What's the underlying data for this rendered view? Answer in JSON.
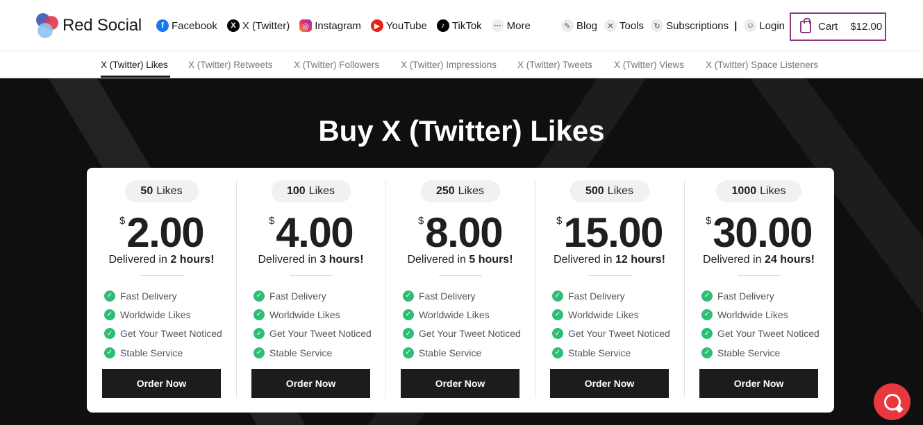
{
  "brand": {
    "name": "Red Social"
  },
  "nav": [
    {
      "label": "Facebook",
      "icon": "facebook-icon",
      "glyph": "f"
    },
    {
      "label": "X (Twitter)",
      "icon": "x-twitter-icon",
      "glyph": "X"
    },
    {
      "label": "Instagram",
      "icon": "instagram-icon",
      "glyph": "◎"
    },
    {
      "label": "YouTube",
      "icon": "youtube-icon",
      "glyph": "▶"
    },
    {
      "label": "TikTok",
      "icon": "tiktok-icon",
      "glyph": "♪"
    },
    {
      "label": "More",
      "icon": "more-icon",
      "glyph": "···"
    }
  ],
  "nav_right": {
    "blog": "Blog",
    "tools": "Tools",
    "subscriptions": "Subscriptions",
    "separator": "|",
    "login": "Login"
  },
  "cart": {
    "label": "Cart",
    "total": "$12.00"
  },
  "subnav": {
    "tabs": [
      {
        "label": "X (Twitter) Likes",
        "active": true
      },
      {
        "label": "X (Twitter) Retweets",
        "active": false
      },
      {
        "label": "X (Twitter) Followers",
        "active": false
      },
      {
        "label": "X (Twitter) Impressions",
        "active": false
      },
      {
        "label": "X (Twitter) Tweets",
        "active": false
      },
      {
        "label": "X (Twitter) Views",
        "active": false
      },
      {
        "label": "X (Twitter) Space Listeners",
        "active": false
      }
    ]
  },
  "hero": {
    "title": "Buy X (Twitter) Likes"
  },
  "plans": [
    {
      "quantity": "50",
      "unit": "Likes",
      "currency": "$",
      "price": "2.00",
      "delivered_prefix": "Delivered in",
      "delivered_time": "2 hours!"
    },
    {
      "quantity": "100",
      "unit": "Likes",
      "currency": "$",
      "price": "4.00",
      "delivered_prefix": "Delivered in",
      "delivered_time": "3 hours!"
    },
    {
      "quantity": "250",
      "unit": "Likes",
      "currency": "$",
      "price": "8.00",
      "delivered_prefix": "Delivered in",
      "delivered_time": "5 hours!"
    },
    {
      "quantity": "500",
      "unit": "Likes",
      "currency": "$",
      "price": "15.00",
      "delivered_prefix": "Delivered in",
      "delivered_time": "12 hours!"
    },
    {
      "quantity": "1000",
      "unit": "Likes",
      "currency": "$",
      "price": "30.00",
      "delivered_prefix": "Delivered in",
      "delivered_time": "24 hours!"
    }
  ],
  "features": [
    "Fast Delivery",
    "Worldwide Likes",
    "Get Your Tweet Noticed",
    "Stable Service"
  ],
  "order_label": "Order Now",
  "colors": {
    "accent": "#8a3a7f",
    "check": "#2ebd74",
    "hero_bg": "#0f0f0f",
    "help": "#e8383d"
  }
}
